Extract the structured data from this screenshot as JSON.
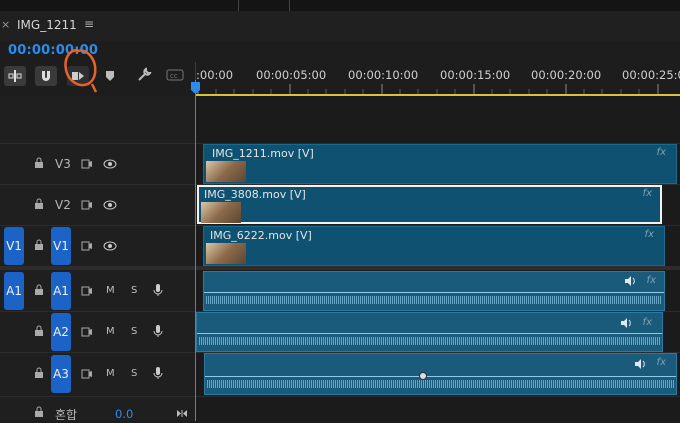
{
  "window": {
    "tab_title": "IMG_1211",
    "close_glyph": "×",
    "menu_glyph": "≡"
  },
  "timecode": "00:00:00:00",
  "ruler": {
    "labels": [
      ":00:00",
      "00:00:05:00",
      "00:00:10:00",
      "00:00:15:00",
      "00:00:20:00",
      "00:00:25:0"
    ]
  },
  "tracks": {
    "video": [
      {
        "id": "V3",
        "clip": "IMG_1211.mov [V]",
        "fx": "fx"
      },
      {
        "id": "V2",
        "clip": "IMG_3808.mov [V]",
        "fx": "fx"
      },
      {
        "id": "V1",
        "source": "V1",
        "clip": "IMG_6222.mov [V]",
        "fx": "fx"
      }
    ],
    "audio": [
      {
        "id": "A1",
        "source": "A1",
        "m": "M",
        "s": "S",
        "fx": "fx"
      },
      {
        "id": "A2",
        "m": "M",
        "s": "S",
        "fx": "fx"
      },
      {
        "id": "A3",
        "m": "M",
        "s": "S",
        "fx": "fx"
      }
    ],
    "mix": {
      "label": "혼합",
      "value": "0.0"
    }
  },
  "colors": {
    "accent_blue": "#2d8ceb",
    "clip_video": "#0e5170",
    "clip_audio": "#1a5a7a",
    "track_tag": "#1b63c7",
    "annotation": "#e8632a"
  }
}
